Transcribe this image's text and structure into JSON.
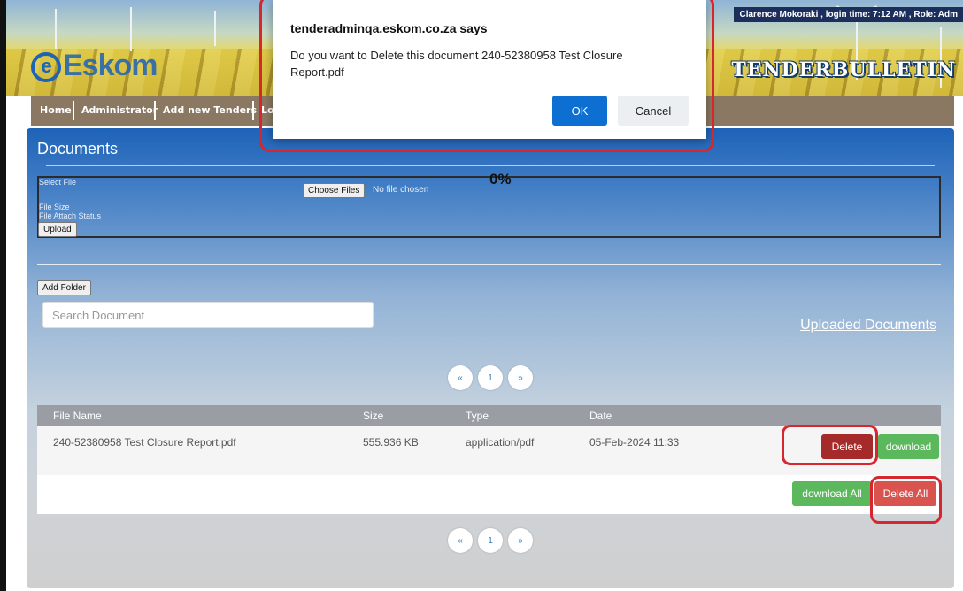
{
  "header": {
    "logo_text": "Eskom",
    "brand": "TENDERBULLETIN",
    "user_info": "Clarence Mokoraki , login time: 7:12 AM , Role: Adm"
  },
  "nav": {
    "items": [
      "Home",
      "Administrator",
      "Add new Tenders",
      "Lo"
    ]
  },
  "documents": {
    "title": "Documents",
    "select_file_label": "Select File",
    "choose_files_label": "Choose Files",
    "no_file_text": "No file chosen",
    "progress": "0%",
    "file_size_label": "File Size",
    "attach_status_label": "File Attach Status",
    "upload_label": "Upload",
    "add_folder_label": "Add Folder",
    "search_placeholder": "Search Document",
    "uploaded_documents_link": "Uploaded Documents",
    "pager": {
      "prev": "«",
      "page": "1",
      "next": "»"
    }
  },
  "table": {
    "columns": [
      "File Name",
      "Size",
      "Type",
      "Date"
    ],
    "rows": [
      {
        "file_name": "240-52380958 Test Closure Report.pdf",
        "size": "555.936 KB",
        "type": "application/pdf",
        "date": "05-Feb-2024 11:33"
      }
    ],
    "delete_label": "Delete",
    "download_label": "download",
    "download_all_label": "download All",
    "delete_all_label": "Delete All"
  },
  "dialog": {
    "title": "tenderadminqa.eskom.co.za says",
    "message": "Do you want to Delete this document 240-52380958 Test Closure Report.pdf",
    "ok_label": "OK",
    "cancel_label": "Cancel"
  },
  "colors": {
    "accent_blue": "#1e63b8",
    "delete_red": "#a52a2a",
    "delete_all_red": "#d9534f",
    "download_green": "#5cb85c",
    "annotation_red": "#d7262e",
    "dialog_ok_blue": "#0d6fd1"
  }
}
